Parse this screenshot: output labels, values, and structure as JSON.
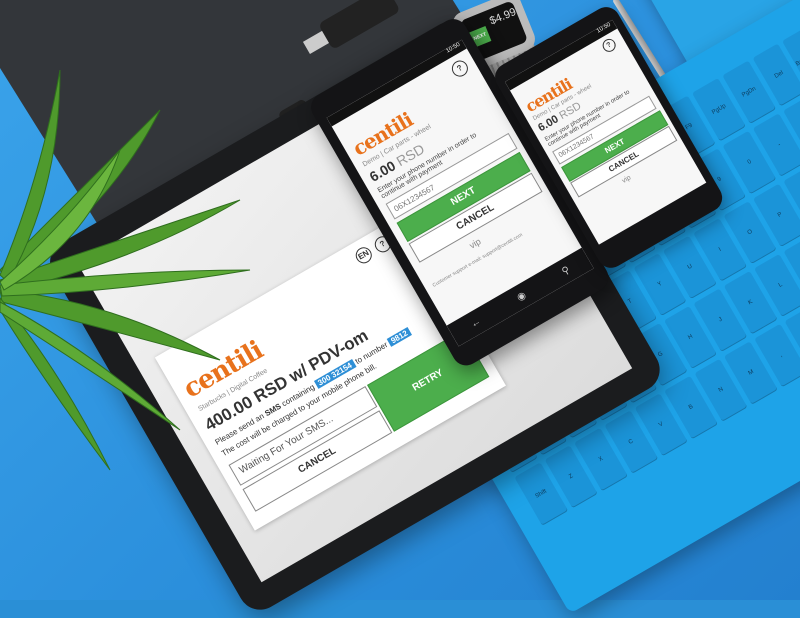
{
  "brand": {
    "logo_text": "centili",
    "accent": "#e8721c",
    "green": "#4cae4c",
    "highlight": "#2e8fd6"
  },
  "tablet": {
    "breadcrumb_merchant": "Starbucks",
    "breadcrumb_item": "Digital Coffee",
    "lang": "EN",
    "help": "?",
    "price": "400.00 RSD w/ PDV-om",
    "instruction_prefix": "Please send an",
    "instruction_sms": "SMS",
    "instruction_mid": "containing",
    "code": "300 32154",
    "instruction_to": "to number",
    "number": "9812",
    "bill_note": "The cost will be charged to your mobile phone bill.",
    "status": "Waiting For Your SMS...",
    "retry_label": "RETRY",
    "cancel_label": "CANCEL"
  },
  "phone_large": {
    "merchant": "Demo",
    "item": "Car parts - wheel",
    "price": "6.00",
    "currency": "RSD",
    "instruction": "Enter your phone number in order to continue with payment",
    "placeholder": "06X1234567",
    "next_label": "NEXT",
    "cancel_label": "CANCEL",
    "operator": "vip",
    "support": "Customer support e-mail: support@centili.com",
    "help": "?",
    "time": "10:50"
  },
  "phone_small": {
    "merchant": "Demo",
    "item": "Car parts - wheel",
    "price": "6.00",
    "currency": "RSD",
    "instruction": "Enter your phone number in order to continue with payment",
    "placeholder": "06X1234567",
    "next_label": "NEXT",
    "cancel_label": "CANCEL",
    "operator": "vip",
    "help": "?",
    "time": "10:50"
  },
  "watch": {
    "price": "$4.99",
    "button": "NEXT"
  },
  "wallet": {
    "badge": "1"
  },
  "keyboard": {
    "keys": [
      "Esc",
      "F1",
      "F2",
      "F3",
      "F4",
      "F5",
      "F6",
      "F7",
      "F8",
      "F9",
      "PgUp",
      "PgDn",
      "Del",
      "Backspace",
      "~",
      "1",
      "2",
      "3",
      "4",
      "5",
      "6",
      "7",
      "8",
      "9",
      "0",
      "-",
      "=",
      "End",
      "Tab",
      "Q",
      "W",
      "E",
      "R",
      "T",
      "Y",
      "U",
      "I",
      "O",
      "P",
      "[",
      "]",
      "\\",
      "Caps",
      "A",
      "S",
      "D",
      "F",
      "G",
      "H",
      "J",
      "K",
      "L",
      ";",
      "'",
      "Enter",
      "",
      "Shift",
      "Z",
      "X",
      "C",
      "V",
      "B",
      "N",
      "M",
      ",",
      ".",
      "/",
      "Shift",
      "",
      ""
    ]
  }
}
